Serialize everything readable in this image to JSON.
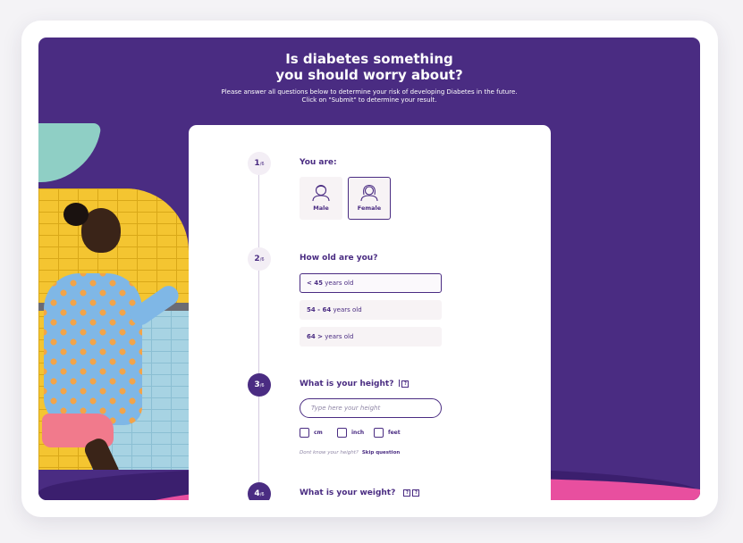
{
  "hero": {
    "title_line1": "Is diabetes something",
    "title_line2": "you should worry about?",
    "subtitle_line1": "Please answer all questions below to determine your risk of developing Diabetes in the future.",
    "subtitle_line2": "Click on \"Submit\" to determine your result."
  },
  "steps": [
    {
      "number": "1",
      "total": "/6",
      "question": "You are:",
      "active": false
    },
    {
      "number": "2",
      "total": "/6",
      "question": "How old are you?",
      "active": false
    },
    {
      "number": "3",
      "total": "/6",
      "question": "What is your height?",
      "active": true
    },
    {
      "number": "4",
      "total": "/6",
      "question": "What is your weight?",
      "active": true
    }
  ],
  "gender": {
    "options": [
      {
        "label": "Male",
        "icon": "male-avatar-icon",
        "selected": false
      },
      {
        "label": "Female",
        "icon": "female-avatar-icon",
        "selected": true
      }
    ]
  },
  "age": {
    "options": [
      {
        "bold": "< 45",
        "text": " years old",
        "selected": true
      },
      {
        "bold": "54 - 64",
        "text": " years old",
        "selected": false
      },
      {
        "bold": "64 >",
        "text": " years old",
        "selected": false
      }
    ]
  },
  "height": {
    "help_symbol": "?",
    "placeholder": "Type here your height",
    "value": "",
    "units": [
      {
        "label": "cm",
        "checked": false
      },
      {
        "label": "inch",
        "checked": false
      },
      {
        "label": "feet",
        "checked": false
      }
    ],
    "unknown_text": "Dont know your height?",
    "skip_label": "Skip question"
  },
  "weight": {
    "help_symbol": "?"
  },
  "colors": {
    "brand_purple": "#4a2c82",
    "accent_pink": "#e84f9f",
    "accent_teal": "#8fcfc5",
    "option_bg": "#f7f3f5"
  }
}
